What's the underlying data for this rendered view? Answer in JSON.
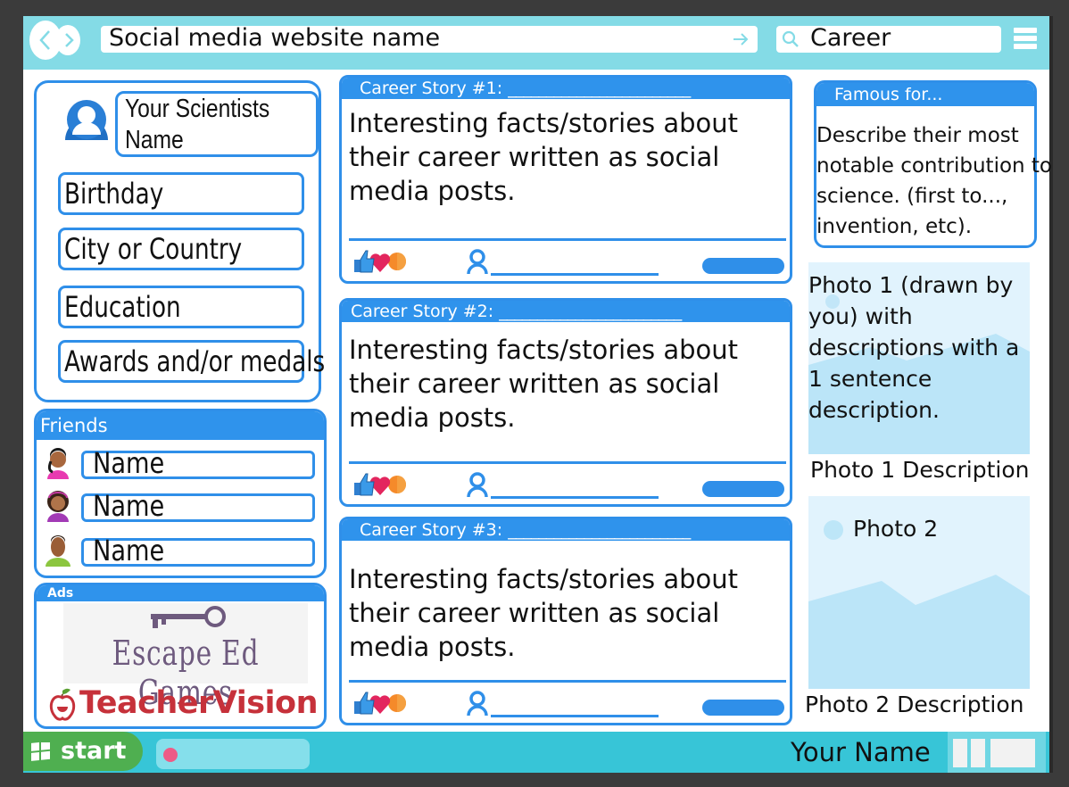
{
  "topbar": {
    "url_text": "Social media website name",
    "search_value": "Career",
    "icons": {
      "back": "chevron-left-icon",
      "forward": "chevron-right-icon",
      "go": "arrow-right-icon",
      "search": "search-icon",
      "menu": "hamburger-menu-icon"
    }
  },
  "profile": {
    "name": "Your Scientists\n Name",
    "fields": [
      {
        "label": "Birthday"
      },
      {
        "label": "City or Country"
      },
      {
        "label": "Education"
      },
      {
        "label": "Awards and/or medals"
      }
    ]
  },
  "friends": {
    "title": "Friends",
    "items": [
      {
        "name": "Name"
      },
      {
        "name": "Name"
      },
      {
        "name": "Name"
      }
    ]
  },
  "ads": {
    "title": "Ads",
    "items": [
      {
        "text": "Escape Ed Games"
      },
      {
        "text": "TeacherVision"
      }
    ]
  },
  "posts": [
    {
      "title": "Career Story #1:",
      "blank": "________________________",
      "body": "Interesting facts/stories about their career written as social media posts."
    },
    {
      "title": "Career Story #2:",
      "blank": "________________________",
      "body": "Interesting facts/stories about their career written as social media posts."
    },
    {
      "title": "Career Story #3:",
      "blank": "________________________",
      "body": "Interesting facts/stories about their career written as social media posts."
    }
  ],
  "famous": {
    "title": "Famous for...",
    "body": "Describe their most notable contribution to science. (first to..., invention, etc)."
  },
  "photos": {
    "photo1_text": "Photo 1 (drawn by you) with descriptions with a 1 sentence description.",
    "photo1_caption": "Photo 1 Description",
    "photo2_label": "Photo 2",
    "photo2_caption": "Photo 2 Description"
  },
  "taskbar": {
    "start_label": "start",
    "user_name": "Your Name"
  },
  "colors": {
    "topbar": "#84dbe6",
    "accent_blue": "#2f8fe9",
    "taskbar": "#37c5d7",
    "start_green": "#4faf50"
  }
}
